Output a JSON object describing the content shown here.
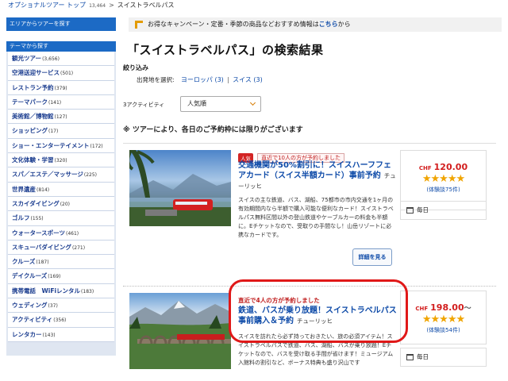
{
  "breadcrumb": {
    "home": "オプショナルツアー トップ",
    "count": "13,464",
    "sep": ">",
    "current": "スイストラベルパス"
  },
  "sidebar": {
    "top_button": "エリアからツアーを探す",
    "header": "テーマから探す",
    "items": [
      {
        "label": "観光ツアー",
        "count": "(3,656)"
      },
      {
        "label": "空港送迎サービス",
        "count": "(501)"
      },
      {
        "label": "レストラン予約",
        "count": "(379)"
      },
      {
        "label": "テーマパーク",
        "count": "(141)"
      },
      {
        "label": "美術館／博物館",
        "count": "(127)"
      },
      {
        "label": "ショッピング",
        "count": "(17)"
      },
      {
        "label": "ショー・エンターテイメント",
        "count": "(172)"
      },
      {
        "label": "文化体験・学習",
        "count": "(320)"
      },
      {
        "label": "スパ／エステ／マッサージ",
        "count": "(225)"
      },
      {
        "label": "世界遺産",
        "count": "(814)"
      },
      {
        "label": "スカイダイビング",
        "count": "(20)"
      },
      {
        "label": "ゴルフ",
        "count": "(155)"
      },
      {
        "label": "ウォータースポーツ",
        "count": "(461)"
      },
      {
        "label": "スキューバダイビング",
        "count": "(271)"
      },
      {
        "label": "クルーズ",
        "count": "(187)"
      },
      {
        "label": "デイクルーズ",
        "count": "(169)"
      },
      {
        "label": "携帯電話　WiFiレンタル",
        "count": "(183)"
      },
      {
        "label": "ウェディング",
        "count": "(37)"
      },
      {
        "label": "アクティビティ",
        "count": "(356)"
      },
      {
        "label": "レンタカー",
        "count": "(143)"
      }
    ]
  },
  "promo": {
    "text": "お得なキャンペーン・定番・季節の商品などおすすめ情報は",
    "link": "こちら",
    "suffix": "から"
  },
  "page_title": "「スイストラベルパス」の検索結果",
  "filter": {
    "label": "絞り込み",
    "origin_label": "出発地を選択:",
    "europe": "ヨーロッパ (3)",
    "divider": "|",
    "swiss": "スイス (3)"
  },
  "sort": {
    "label": "3アクティビティ",
    "selected": "人気順"
  },
  "notice": "※ ツアーにより、各日のご予約枠には限りがございます",
  "results": [
    {
      "badge_popular": "人気",
      "badge_recent": "直近で10人の方が予約しました",
      "title": "交通機関が50%割引に！スイスハーフフェアカード（スイス半額カード）事前予約",
      "city": "チューリッヒ",
      "description": "スイスの主な鉄道、バス、湖船、75都市の市内交通を1ヶ月の有効期間内なら半額で購入可能な便利なカード！スイストラベルパス無料区間以外の登山鉄道やケーブルカーの料金も半額に。Eチケットなので、受取りの手間なし！山岳リゾートに必携なカードです。",
      "currency": "CHF",
      "price": "120.00",
      "tilde": "",
      "stars": "★★★★★",
      "reviews": "(体験談75件)",
      "schedule": "毎日",
      "detail_button": "詳細を見る"
    },
    {
      "badge_popular": "",
      "badge_recent": "直近で4人の方が予約しました",
      "title": "鉄道、バスが乗り放題！スイストラベルパス事前購入＆予約",
      "city": "チューリッヒ",
      "description": "スイスを訪れたら必ず持っておきたい、旅の必須アイテム！スイストラベルパスで鉄道、バス、湖船、バスが乗り放題！Eチケットなので、バスを受け取る手間が省けます！ミュージアム入館料の割引など、ボーナス特典も盛り沢山です",
      "currency": "CHF",
      "price": "198.00",
      "tilde": "～",
      "stars": "★★★★★",
      "reviews": "(体験談54件)",
      "schedule": "毎日",
      "detail_button": ""
    }
  ],
  "colors": {
    "link": "#0d4aa8",
    "sidebar_blue": "#1c6ac5",
    "price_red": "#d21d1d",
    "star": "#f0a400",
    "highlight": "#e01818"
  }
}
